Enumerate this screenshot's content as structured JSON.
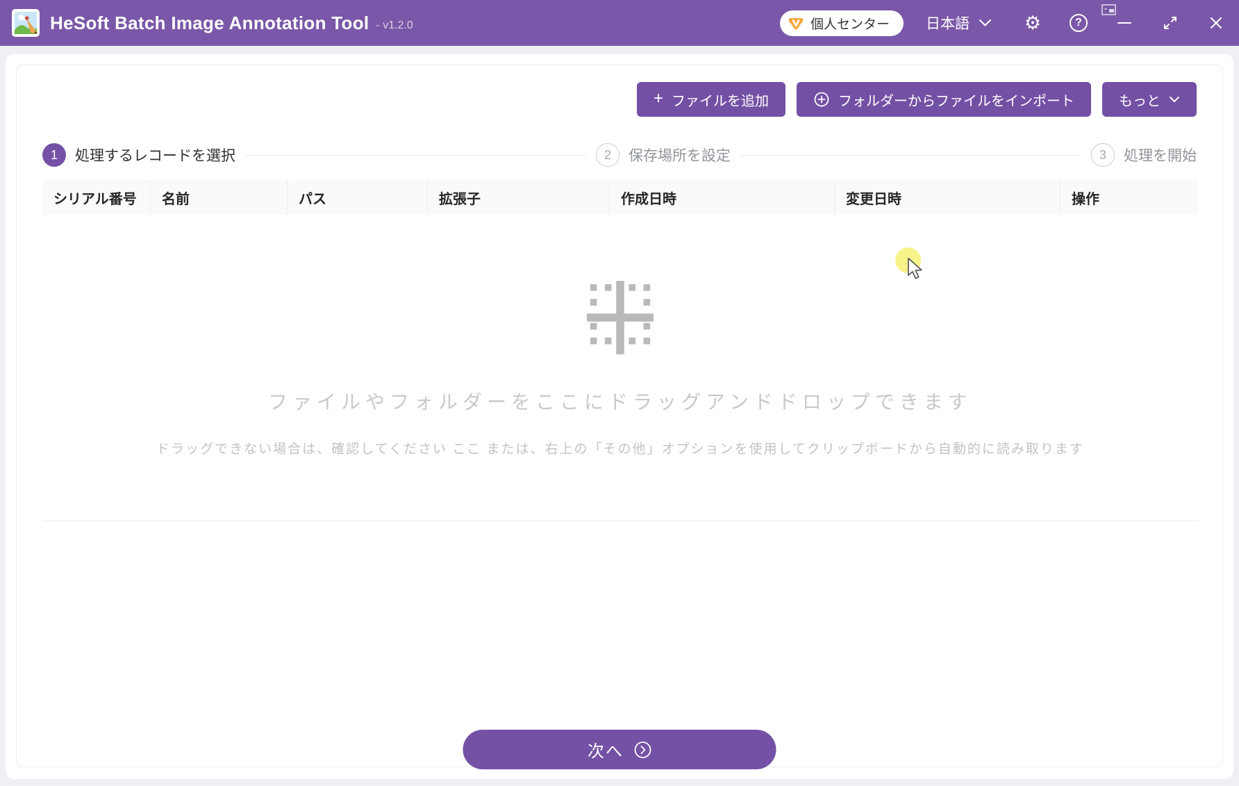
{
  "titlebar": {
    "app_title": "HeSoft Batch Image Annotation Tool",
    "version": "- v1.2.0",
    "personal_center_label": "個人センター",
    "language_label": "日本語"
  },
  "toolbar": {
    "add_files_label": "ファイルを追加",
    "import_folder_label": "フォルダーからファイルをインポート",
    "more_label": "もっと"
  },
  "steps": [
    {
      "num": "1",
      "label": "処理するレコードを選択"
    },
    {
      "num": "2",
      "label": "保存場所を設定"
    },
    {
      "num": "3",
      "label": "処理を開始"
    }
  ],
  "table": {
    "columns": [
      "シリアル番号",
      "名前",
      "パス",
      "拡張子",
      "作成日時",
      "変更日時",
      "操作"
    ],
    "rows": []
  },
  "empty_state": {
    "main_text": "ファイルやフォルダーをここにドラッグアンドドロップできます",
    "hint_text": "ドラッグできない場合は、確認してください  ここ  または、右上の「その他」オプションを使用してクリップボードから自動的に読み取ります"
  },
  "footer": {
    "next_label": "次へ"
  },
  "colors": {
    "titlebar_purple": "#7a57a8",
    "button_purple": "#7450a5",
    "highlight_yellow": "#f8f185",
    "badge_amber": "#f5a63b"
  }
}
